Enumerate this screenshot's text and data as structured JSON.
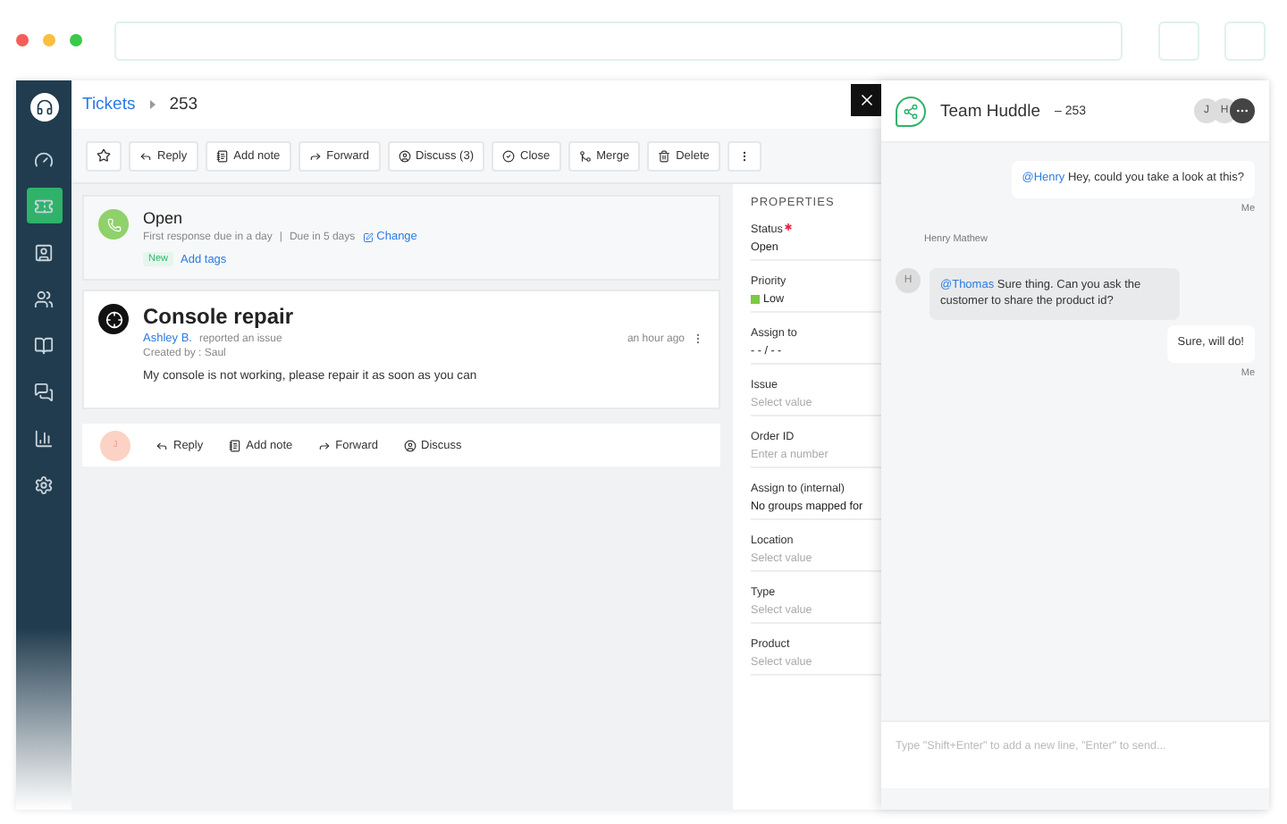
{
  "sidebar": {
    "items": [
      {
        "kind": "dashboard",
        "selected": false
      },
      {
        "kind": "tickets",
        "selected": true
      },
      {
        "kind": "contacts",
        "selected": false
      },
      {
        "kind": "groups",
        "selected": false
      },
      {
        "kind": "book",
        "selected": false
      },
      {
        "kind": "chat",
        "selected": false
      },
      {
        "kind": "reports",
        "selected": false
      },
      {
        "kind": "settings",
        "selected": false
      }
    ]
  },
  "breadcrumb": {
    "parent": "Tickets",
    "current": "253"
  },
  "toolbar": {
    "buttons": [
      {
        "kind": "reply",
        "label": "Reply"
      },
      {
        "kind": "note",
        "label": "Add note"
      },
      {
        "kind": "forward",
        "label": "Forward"
      },
      {
        "kind": "discuss",
        "label": "Discuss (3)"
      },
      {
        "kind": "close",
        "label": "Close"
      },
      {
        "kind": "merge",
        "label": "Merge"
      },
      {
        "kind": "delete",
        "label": "Delete"
      }
    ]
  },
  "status_card": {
    "status": "Open",
    "first_response": "First response due in a day",
    "separator": "|",
    "due": "Due in 5 days",
    "change": "Change",
    "tag": "New",
    "add_tags": "Add tags"
  },
  "ticket": {
    "title": "Console repair",
    "author": "Ashley B.",
    "action": "reported an issue",
    "created_by": "Created by : Saul",
    "time": "an hour ago",
    "body": "My console is not working, please repair it as soon as you can"
  },
  "reply_bar": {
    "avatar": "J",
    "actions": [
      {
        "kind": "reply",
        "label": "Reply"
      },
      {
        "kind": "note",
        "label": "Add note"
      },
      {
        "kind": "forward",
        "label": "Forward"
      },
      {
        "kind": "discuss",
        "label": "Discuss"
      }
    ]
  },
  "properties": {
    "title": "PROPERTIES",
    "fields": [
      {
        "label": "Status",
        "required": true,
        "value": "Open"
      },
      {
        "label": "Priority",
        "required": false,
        "value": "Low",
        "color": "#7ac943"
      },
      {
        "label": "Assign to",
        "required": false,
        "value": "- - / - -"
      },
      {
        "label": "Issue",
        "required": false,
        "placeholder": "Select value"
      },
      {
        "label": "Order ID",
        "required": false,
        "placeholder": "Enter a number"
      },
      {
        "label": "Assign to (internal)",
        "required": false,
        "value": "No groups mapped for"
      },
      {
        "label": "Location",
        "required": false,
        "placeholder": "Select value"
      },
      {
        "label": "Type",
        "required": false,
        "placeholder": "Select value"
      },
      {
        "label": "Product",
        "required": false,
        "placeholder": "Select value"
      }
    ]
  },
  "chat": {
    "title": "Team Huddle",
    "ticket": "– 253",
    "participants": [
      "J",
      "H"
    ],
    "messages": [
      {
        "kind": "own",
        "mention": "@Henry",
        "text": "Hey, could you take a look at this?",
        "sender": "Me"
      },
      {
        "kind": "other",
        "author": "Henry Mathew",
        "avatar": "H",
        "mention": "@Thomas",
        "text": "Sure thing. Can you ask the customer to share the product id?"
      },
      {
        "kind": "own",
        "text": "Sure, will do!",
        "sender": "Me"
      }
    ],
    "placeholder": "Type \"Shift+Enter\" to add a new line, \"Enter\" to send..."
  }
}
